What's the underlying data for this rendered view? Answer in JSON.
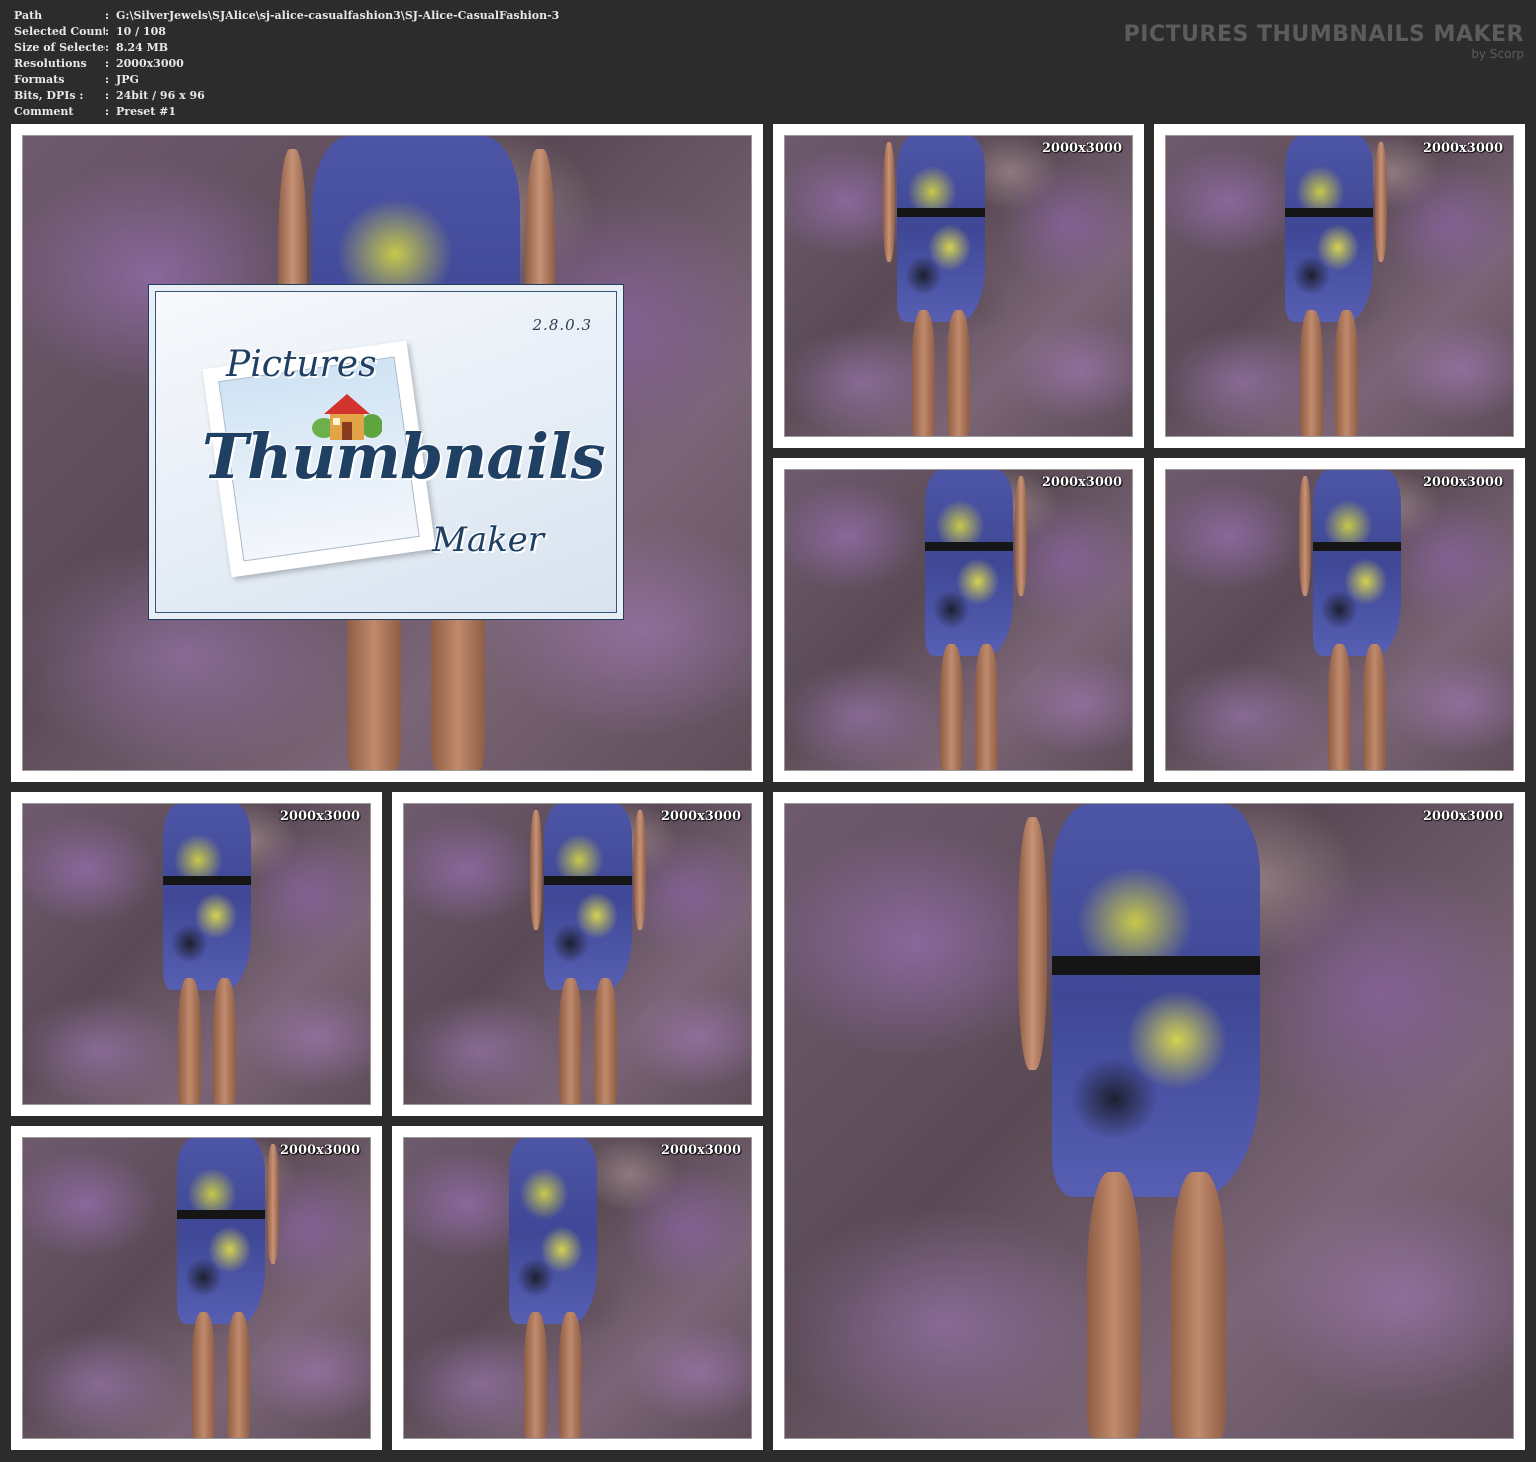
{
  "info": {
    "rows": [
      {
        "key": "Path",
        "sep": ":",
        "value": "G:\\SilverJewels\\SJAlice\\sj-alice-casualfashion3\\SJ-Alice-CasualFashion-3"
      },
      {
        "key": "Selected Count",
        "sep": ":",
        "value": "10 / 108"
      },
      {
        "key": "Size of Selected",
        "sep": ":",
        "value": "8.24 MB"
      },
      {
        "key": "Resolutions",
        "sep": ":",
        "value": "2000x3000"
      },
      {
        "key": "Formats",
        "sep": ":",
        "value": "JPG"
      },
      {
        "key": "Bits, DPIs :",
        "sep": ":",
        "value": "24bit / 96 x 96"
      },
      {
        "key": "Comment",
        "sep": ":",
        "value": "Preset #1"
      }
    ]
  },
  "brand": {
    "title": "PICTURES THUMBNAILS MAKER",
    "subtitle": "by Scorp"
  },
  "logo": {
    "version": "2.8.0.3",
    "word1": "Pictures",
    "word2": "Thumbnails",
    "word3": "Maker"
  },
  "thumbnails": [
    {
      "label": ""
    },
    {
      "label": "2000x3000"
    },
    {
      "label": "2000x3000"
    },
    {
      "label": "2000x3000"
    },
    {
      "label": "2000x3000"
    },
    {
      "label": "2000x3000"
    },
    {
      "label": "2000x3000"
    },
    {
      "label": "2000x3000"
    },
    {
      "label": "2000x3000"
    },
    {
      "label": "2000x3000"
    }
  ],
  "colors": {
    "background": "#2c2c2c",
    "frame": "#ffffff",
    "brand_text": "#5c5c5c",
    "logo_text": "#1f3f63"
  }
}
